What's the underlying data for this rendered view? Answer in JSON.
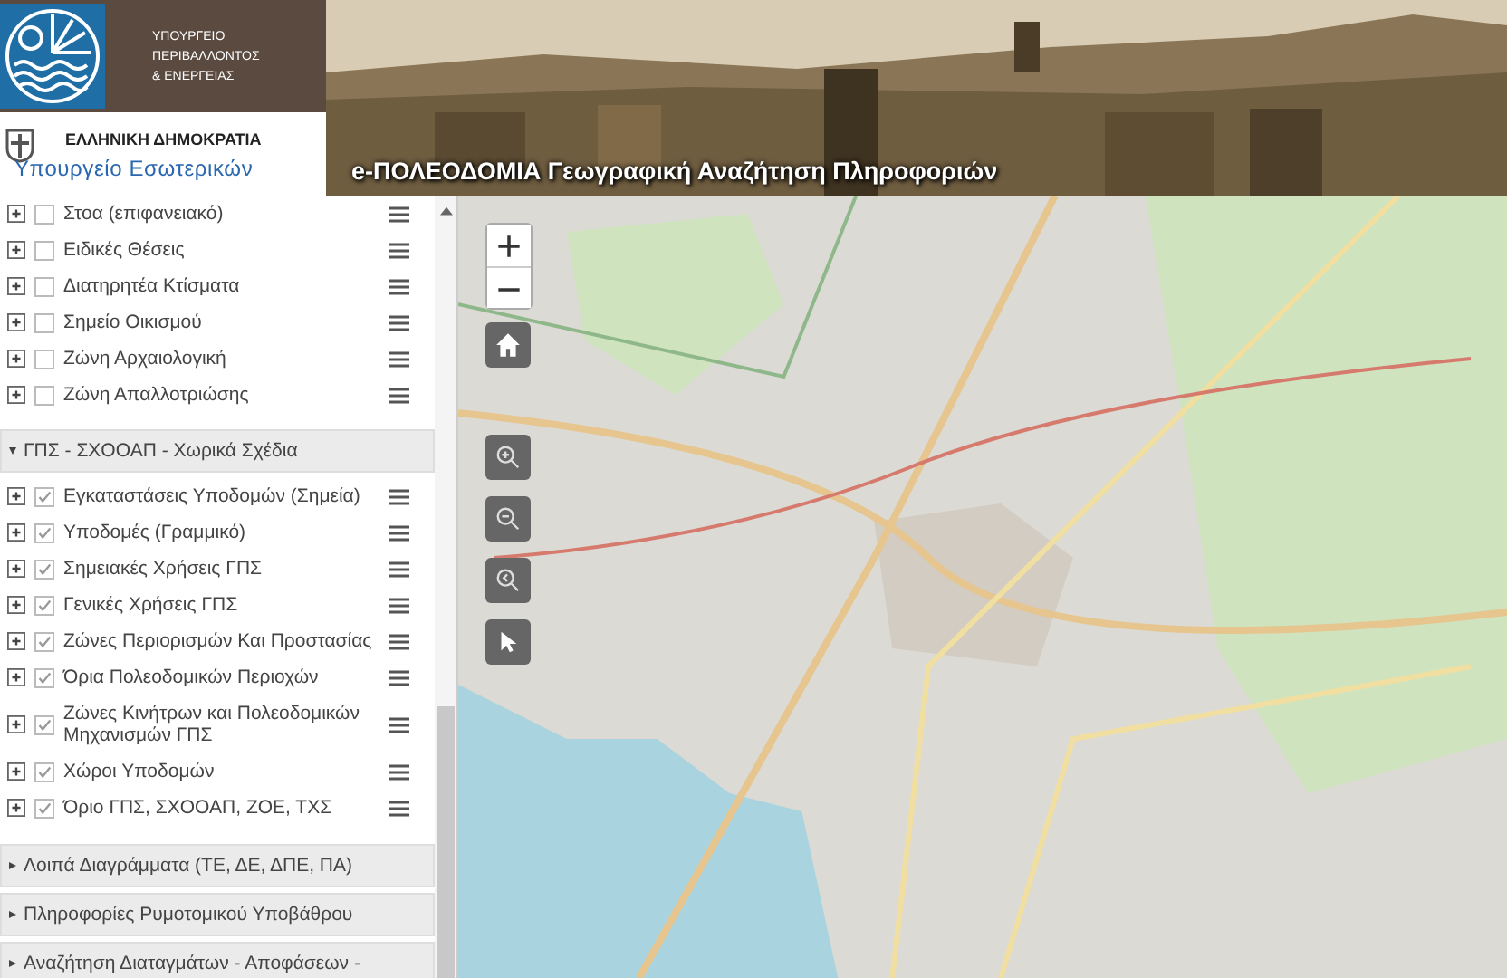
{
  "header": {
    "ministry_lines": [
      "ΥΠΟΥΡΓΕΙΟ",
      "ΠΕΡΙΒΑΛΛΟΝΤΟΣ",
      "& ΕΝΕΡΓΕΙΑΣ"
    ],
    "republic": "ΕΛΛΗΝΙΚΗ ΔΗΜΟΚΡΑΤΙΑ",
    "ministry_interior": "Υπουργείο Εσωτερικών",
    "title": "e-ΠΟΛΕΟΔΟΜΙΑ Γεωγραφική Αναζήτηση Πληροφοριών"
  },
  "sidebar": {
    "layers": [
      {
        "label": "Στοα (επιφανειακό)",
        "checked": false
      },
      {
        "label": "Ειδικές Θέσεις",
        "checked": false
      },
      {
        "label": "Διατηρητέα Κτίσματα",
        "checked": false
      },
      {
        "label": "Σημείο Οικισμού",
        "checked": false
      },
      {
        "label": "Ζώνη Αρχαιολογική",
        "checked": false
      },
      {
        "label": "Ζώνη Απαλλοτριώσης",
        "checked": false
      }
    ],
    "groups": [
      {
        "title": "ΓΠΣ - ΣΧΟΟΑΠ - Χωρικά Σχέδια",
        "expanded": true,
        "layers": [
          {
            "label": "Εγκαταστάσεις Υποδομών (Σημεία)",
            "checked": true
          },
          {
            "label": "Υποδομές (Γραμμικό)",
            "checked": true
          },
          {
            "label": "Σημειακές Χρήσεις ΓΠΣ",
            "checked": true
          },
          {
            "label": "Γενικές Χρήσεις ΓΠΣ",
            "checked": true
          },
          {
            "label": "Ζώνες Περιορισμών Και Προστασίας",
            "checked": true
          },
          {
            "label": "Όρια Πολεοδομικών Περιοχών",
            "checked": true
          },
          {
            "label": "Ζώνες Κινήτρων και Πολεοδομικών Μηχανισμών ΓΠΣ",
            "checked": true
          },
          {
            "label": "Χώροι Υποδομών",
            "checked": true
          },
          {
            "label": "Όριο ΓΠΣ, ΣΧΟΟΑΠ, ΖΟΕ, ΤΧΣ",
            "checked": true
          }
        ]
      },
      {
        "title": "Λοιπά Διαγράμματα (ΤΕ, ΔΕ, ΔΠΕ, ΠΑ)",
        "expanded": false
      },
      {
        "title": "Πληροφορίες Ρυμοτομικού Υποβάθρου",
        "expanded": false
      },
      {
        "title": "Αναζήτηση Διαταγμάτων - Αποφάσεων -",
        "expanded": false
      }
    ]
  }
}
